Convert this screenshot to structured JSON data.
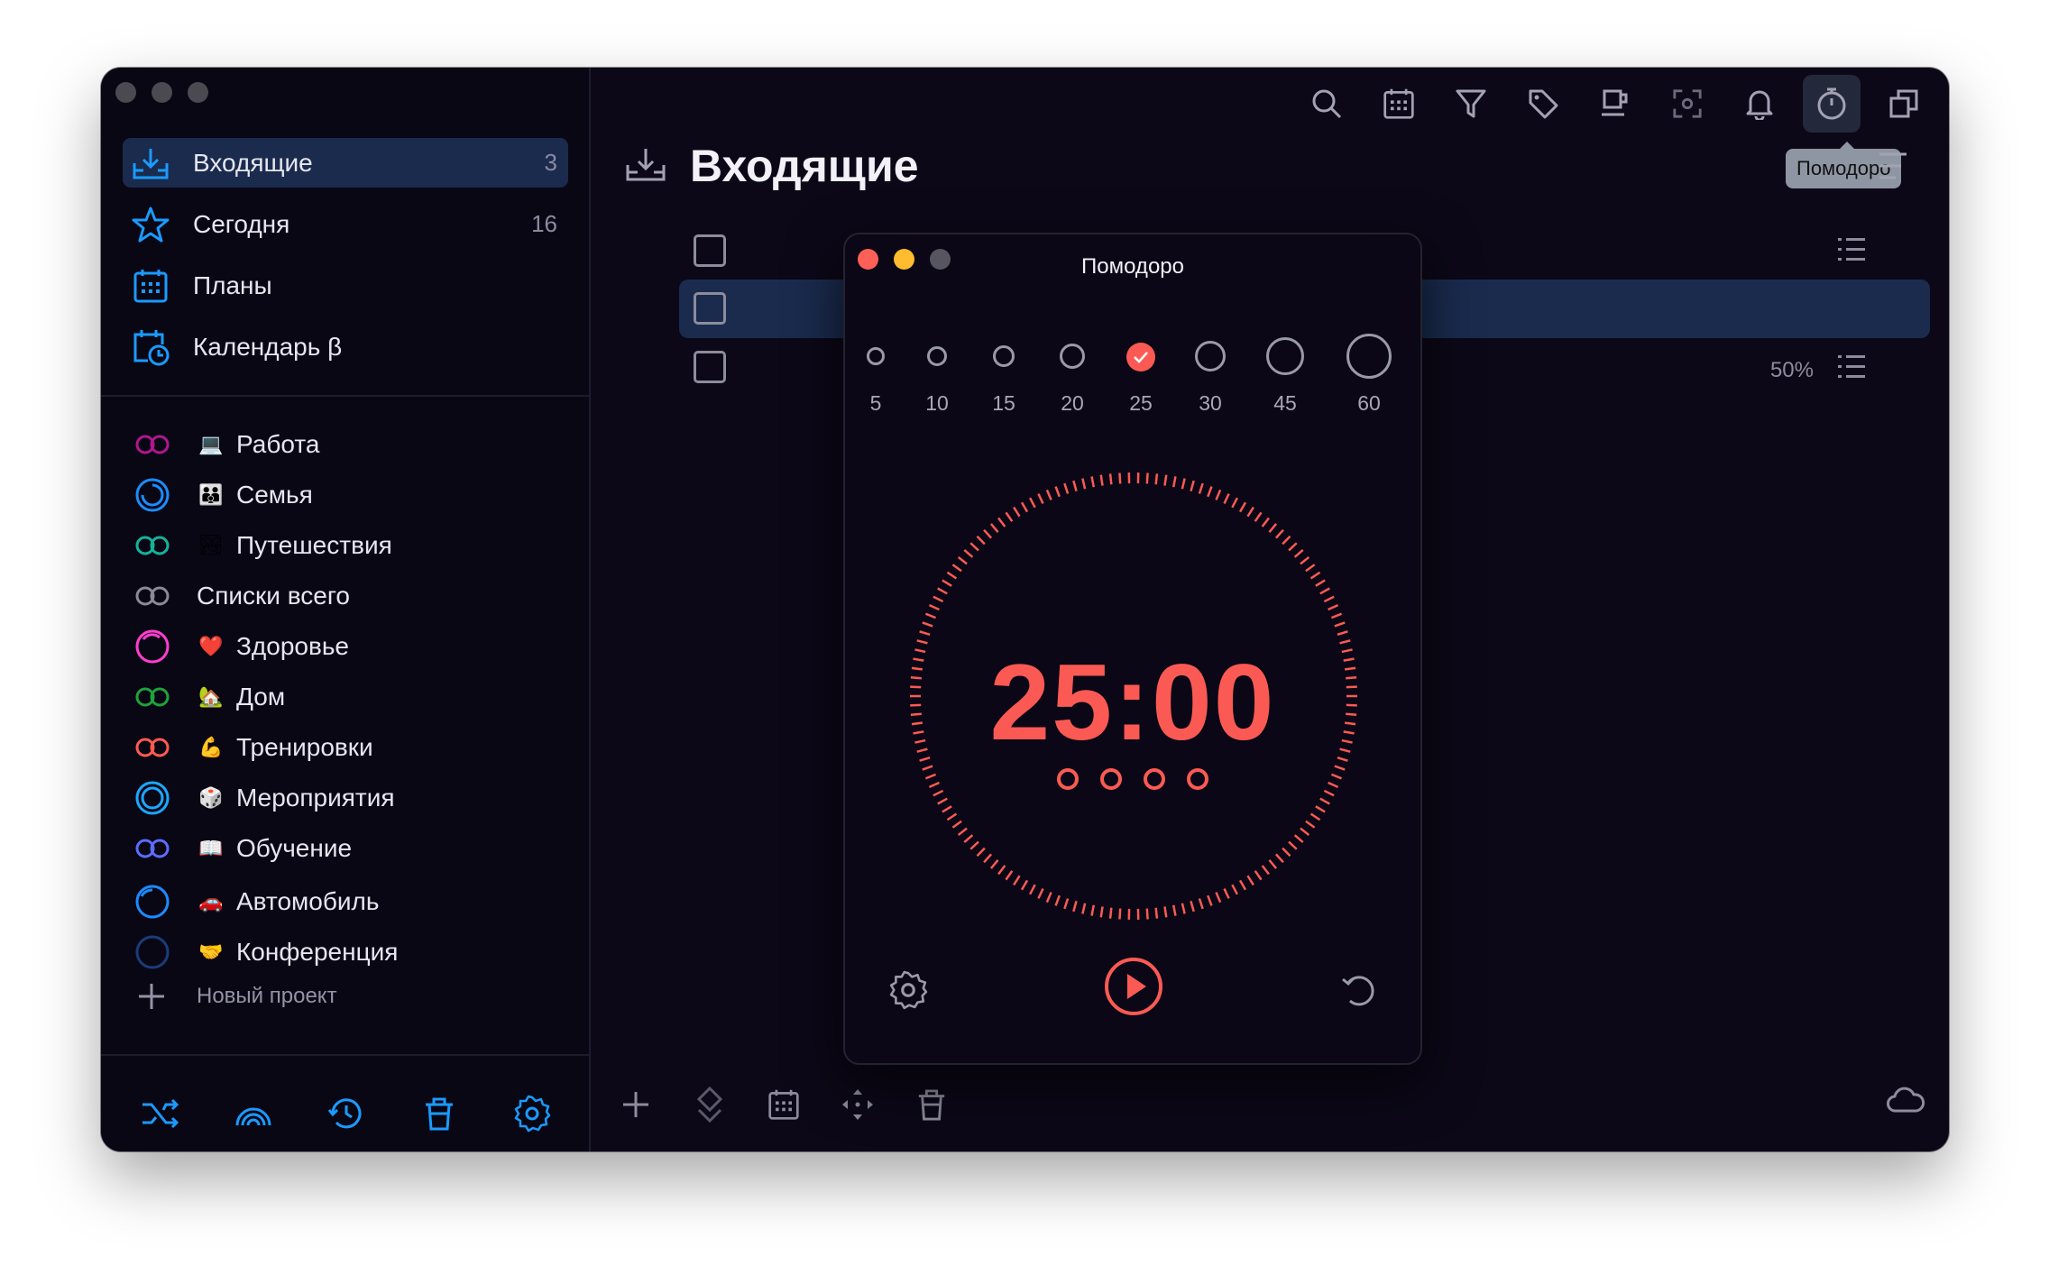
{
  "sidebar": {
    "nav": [
      {
        "label": "Входящие",
        "count": "3",
        "icon": "inbox-icon"
      },
      {
        "label": "Сегодня",
        "count": "16",
        "icon": "star-icon"
      },
      {
        "label": "Планы",
        "count": "",
        "icon": "calendar-grid-icon"
      },
      {
        "label": "Календарь β",
        "count": "",
        "icon": "calendar-clock-icon"
      }
    ],
    "projects": [
      {
        "label": "Работа",
        "emoji": "💻",
        "ring_color": "#b0168e"
      },
      {
        "label": "Семья",
        "emoji": "👪",
        "ring_color": "#1a8cff"
      },
      {
        "label": "Путешествия",
        "emoji": "🏞",
        "ring_color": "#14b39a"
      },
      {
        "label": "Списки всего",
        "emoji": "",
        "ring_color": "#8a8a96"
      },
      {
        "label": "Здоровье",
        "emoji": "❤️",
        "ring_color": "#ff3ecf"
      },
      {
        "label": "Дом",
        "emoji": "🏡",
        "ring_color": "#1fa23a"
      },
      {
        "label": "Тренировки",
        "emoji": "💪",
        "ring_color": "#ff5a4f"
      },
      {
        "label": "Мероприятия",
        "emoji": "🎲",
        "ring_color": "#1aa8ff"
      },
      {
        "label": "Обучение",
        "emoji": "📖",
        "ring_color": "#5c6cff"
      },
      {
        "label": "Автомобиль",
        "emoji": "🚗",
        "ring_color": "#1a8cff"
      },
      {
        "label": "Конференция",
        "emoji": "🤝",
        "ring_color": "#1a3c7a"
      }
    ],
    "new_project_label": "Новый проект",
    "bottom_icons": [
      "shuffle-icon",
      "rainbow-icon",
      "history-icon",
      "trash-icon",
      "gear-icon"
    ]
  },
  "main": {
    "title": "Входящие",
    "tooltip": "Помодоро",
    "progress_label": "50%",
    "toolbar_icons": [
      "search-icon",
      "calendar-grid-icon",
      "filter-icon",
      "tag-icon",
      "coffee-icon",
      "focus-icon",
      "bell-icon",
      "timer-icon",
      "copy-icon"
    ],
    "bottom_icons": [
      "plus-icon",
      "diamond-icon",
      "calendar-grid-icon",
      "move-icon",
      "trash-icon"
    ]
  },
  "pomodoro": {
    "title": "Помодоро",
    "durations": [
      "5",
      "10",
      "15",
      "20",
      "25",
      "30",
      "45",
      "60"
    ],
    "selected": "25",
    "time": "25:00",
    "sessions": 4,
    "accent": "#fb5a54"
  },
  "colors": {
    "bg": "#0c0818",
    "active_row": "#1a2b4e",
    "accent_blue": "#1a9bff"
  }
}
